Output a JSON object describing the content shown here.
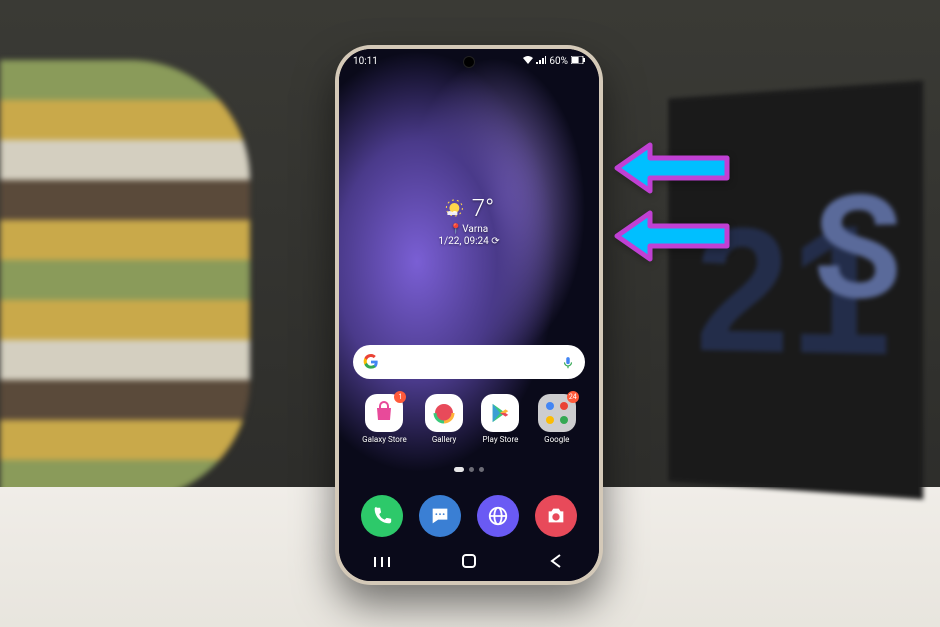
{
  "status": {
    "time": "10:11",
    "battery": "60%"
  },
  "weather": {
    "temp": "7°",
    "location_icon": "📍",
    "location": "Varna",
    "date": "1/22, 09:24",
    "refresh_icon": "⟳"
  },
  "apps": {
    "row": [
      {
        "label": "Galaxy Store",
        "badge": "1",
        "bg": "#ffffff"
      },
      {
        "label": "Gallery",
        "badge": "",
        "bg": "#ffffff"
      },
      {
        "label": "Play Store",
        "badge": "",
        "bg": "#ffffff"
      },
      {
        "label": "Google",
        "badge": "24",
        "bg": "#f0f0f0"
      }
    ]
  },
  "dock": [
    {
      "name": "phone",
      "bg": "#2dc96a"
    },
    {
      "name": "messages",
      "bg": "#3a7fd4"
    },
    {
      "name": "browser",
      "bg": "#6a5af4"
    },
    {
      "name": "camera",
      "bg": "#e84a5a"
    }
  ],
  "box": {
    "number": "21",
    "letter": "S"
  },
  "colors": {
    "arrow_fill": "#00bfff",
    "arrow_stroke": "#c040d4"
  }
}
